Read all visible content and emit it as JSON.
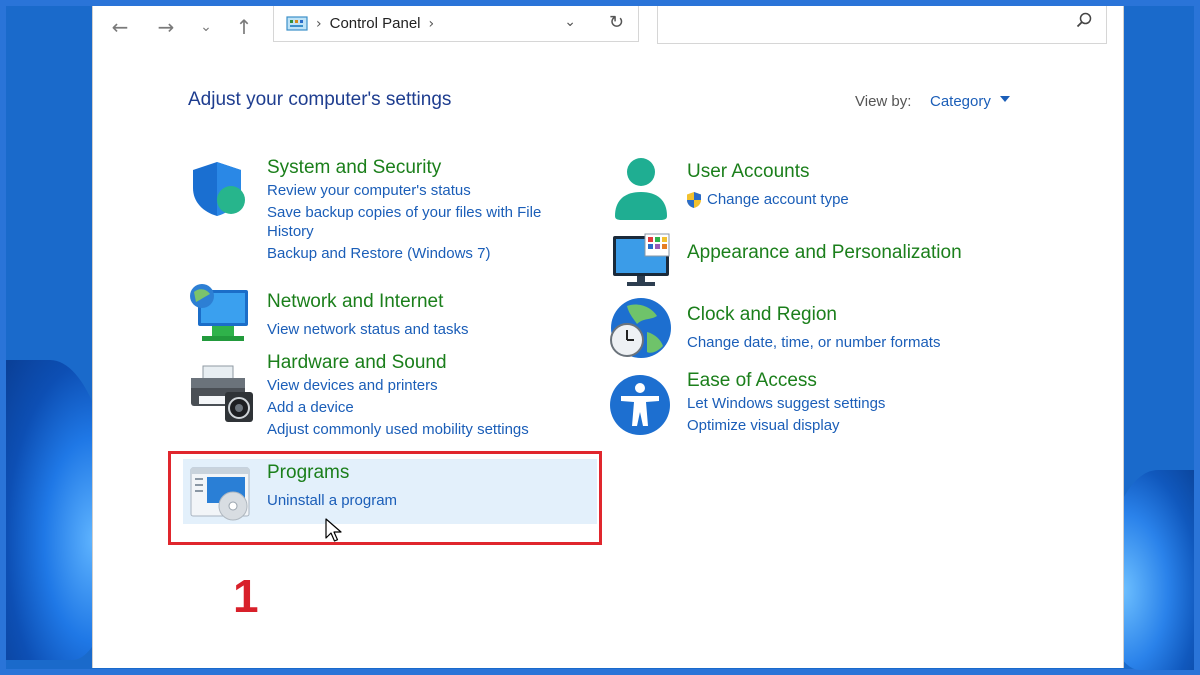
{
  "toolbar": {
    "back": "←",
    "forward": "→",
    "recent": "⌄",
    "up": "↑",
    "address_sep1": "›",
    "address_text": "Control Panel",
    "address_sep2": "›",
    "dropdown": "⌄",
    "refresh": "↻",
    "search_placeholder": ""
  },
  "header": {
    "title": "Adjust your computer's settings",
    "view_by_label": "View by:",
    "view_by_value": "Category"
  },
  "left_categories": [
    {
      "title": "System and Security",
      "icon": "shield-icon",
      "links": [
        "Review your computer's status",
        "Save backup copies of your files with File",
        "History",
        "Backup and Restore (Windows 7)"
      ]
    },
    {
      "title": "Network and Internet",
      "icon": "network-icon",
      "links": [
        "View network status and tasks"
      ]
    },
    {
      "title": "Hardware and Sound",
      "icon": "printer-icon",
      "links": [
        "View devices and printers",
        "Add a device",
        "Adjust commonly used mobility settings"
      ]
    },
    {
      "title": "Programs",
      "icon": "programs-icon",
      "links": [
        "Uninstall a program"
      ]
    }
  ],
  "right_categories": [
    {
      "title": "User Accounts",
      "icon": "user-icon",
      "links": [
        "Change account type"
      ]
    },
    {
      "title": "Appearance and Personalization",
      "icon": "monitor-icon",
      "links": []
    },
    {
      "title": "Clock and Region",
      "icon": "clock-icon",
      "links": [
        "Change date, time, or number formats"
      ]
    },
    {
      "title": "Ease of Access",
      "icon": "accessibility-icon",
      "links": [
        "Let Windows suggest settings",
        "Optimize visual display"
      ]
    }
  ],
  "annotation": {
    "step_number": "1",
    "highlight_color": "#e0262d"
  },
  "colors": {
    "category_title": "#1b7f1b",
    "link": "#1b5eb8",
    "frame": "#2a74d8"
  }
}
